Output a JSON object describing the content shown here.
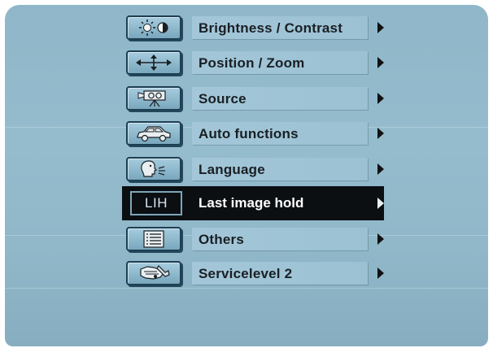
{
  "menu": {
    "items": [
      {
        "label": "Brightness / Contrast",
        "icon": "sun-contrast-icon"
      },
      {
        "label": "Position / Zoom",
        "icon": "move-arrows-icon"
      },
      {
        "label": "Source",
        "icon": "projector-icon"
      },
      {
        "label": "Auto functions",
        "icon": "car-icon"
      },
      {
        "label": "Language",
        "icon": "speaking-head-icon"
      },
      {
        "label": "Last image hold",
        "icon_text": "LIH",
        "selected": true
      },
      {
        "label": "Others",
        "icon": "list-icon"
      },
      {
        "label": "Servicelevel 2",
        "icon": "wrench-hand-icon"
      }
    ]
  },
  "colors": {
    "screen": "#90b8c9",
    "selected_background": "#0b0f12",
    "selected_text": "#ffffff",
    "text": "#1a1f24"
  }
}
